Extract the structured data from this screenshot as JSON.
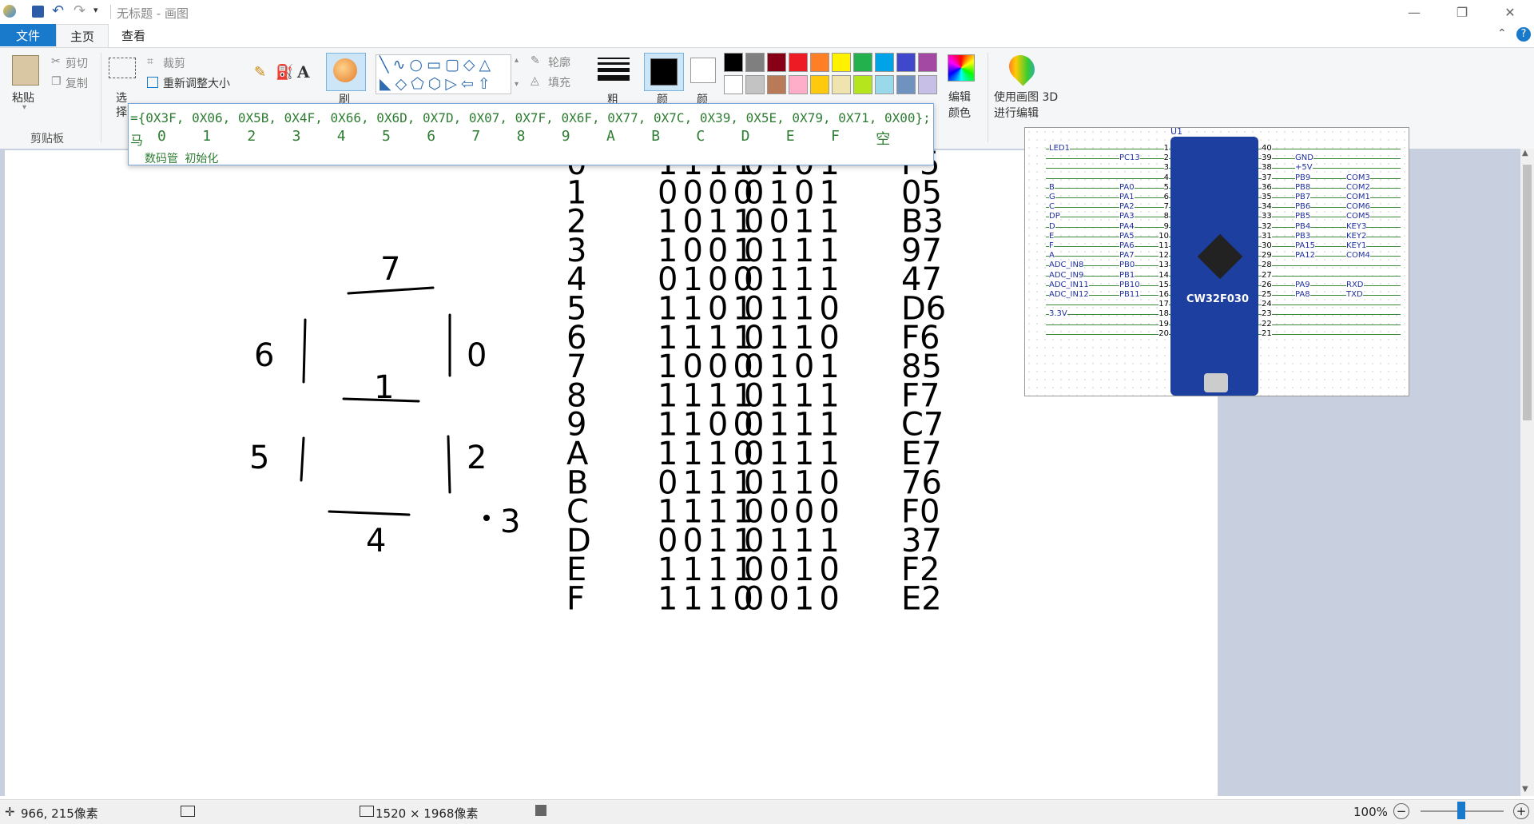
{
  "window": {
    "title": "无标题 - 画图"
  },
  "tabs": {
    "file": "文件",
    "home": "主页",
    "view": "查看"
  },
  "ribbon": {
    "paste": "粘贴",
    "cut": "剪切",
    "copy": "复制",
    "clipboard_group": "剪贴板",
    "select": "选择",
    "crop": "裁剪",
    "resize": "重新调整大小",
    "brush": "刷",
    "outline": "轮廓",
    "fill": "填充",
    "size": "粗",
    "color1": "颜",
    "color2": "颜",
    "edit_colors": "编辑颜色",
    "paint3d": "使用画图 3D 进行编辑",
    "colors": [
      "#000000",
      "#7f7f7f",
      "#880015",
      "#ed1c24",
      "#ff7f27",
      "#fff200",
      "#22b14c",
      "#00a2e8",
      "#3f48cc",
      "#a349a4",
      "#ffffff",
      "#c3c3c3",
      "#b97a57",
      "#ffaec9",
      "#ffc90e",
      "#efe4b0",
      "#b5e61d",
      "#99d9ea",
      "#7092be",
      "#c8bfe7"
    ]
  },
  "code_popup": {
    "line1": "={0X3F, 0X06, 0X5B, 0X4F, 0X66, 0X6D, 0X7D, 0X07, 0X7F, 0X6F, 0X77, 0X7C, 0X39, 0X5E, 0X79, 0X71, 0X00};",
    "line2_prefix": "马",
    "line2_items": [
      "0",
      "1",
      "2",
      "3",
      "4",
      "5",
      "6",
      "7",
      "8",
      "9",
      "A",
      "B",
      "C",
      "D",
      "E",
      "F",
      "空"
    ],
    "line3": "数码管  初始化"
  },
  "drawing": {
    "segments": {
      "top": "7",
      "upper_left": "6",
      "upper_right": "0",
      "middle": "1",
      "lower_left": "5",
      "lower_right": "2",
      "dot": "3",
      "bottom": "4"
    },
    "table": [
      {
        "digit": "0",
        "high": "1111",
        "low": "0101",
        "hex": "F5"
      },
      {
        "digit": "1",
        "high": "0000",
        "low": "0101",
        "hex": "05"
      },
      {
        "digit": "2",
        "high": "1011",
        "low": "0011",
        "hex": "B3"
      },
      {
        "digit": "3",
        "high": "1001",
        "low": "0111",
        "hex": "97"
      },
      {
        "digit": "4",
        "high": "0100",
        "low": "0111",
        "hex": "47"
      },
      {
        "digit": "5",
        "high": "1101",
        "low": "0110",
        "hex": "D6"
      },
      {
        "digit": "6",
        "high": "1111",
        "low": "0110",
        "hex": "F6"
      },
      {
        "digit": "7",
        "high": "1000",
        "low": "0101",
        "hex": "85"
      },
      {
        "digit": "8",
        "high": "1111",
        "low": "0111",
        "hex": "F7"
      },
      {
        "digit": "9",
        "high": "1100",
        "low": "0111",
        "hex": "C7"
      },
      {
        "digit": "A",
        "high": "1110",
        "low": "0111",
        "hex": "E7"
      },
      {
        "digit": "B",
        "high": "0111",
        "low": "0110",
        "hex": "76"
      },
      {
        "digit": "C",
        "high": "1111",
        "low": "0000",
        "hex": "F0"
      },
      {
        "digit": "D",
        "high": "0011",
        "low": "0111",
        "hex": "37"
      },
      {
        "digit": "E",
        "high": "1111",
        "low": "0010",
        "hex": "F2"
      },
      {
        "digit": "F",
        "high": "1110",
        "low": "0010",
        "hex": "E2"
      }
    ]
  },
  "schematic": {
    "chip": "CW32F030",
    "ref": "U1",
    "left_nets": [
      "LED1",
      "",
      "",
      "",
      "B",
      "G",
      "C",
      "DP",
      "D",
      "E",
      "F",
      "A",
      "ADC_IN8",
      "ADC_IN9",
      "ADC_IN11",
      "ADC_IN12",
      "",
      "3.3V",
      "",
      ""
    ],
    "left_pins": [
      "",
      "PC13",
      "",
      "",
      "PA0",
      "PA1",
      "PA2",
      "PA3",
      "PA4",
      "PA5",
      "PA6",
      "PA7",
      "PB0",
      "PB1",
      "PB10",
      "PB11",
      "",
      "",
      "",
      ""
    ],
    "left_nums": [
      "1",
      "2",
      "3",
      "4",
      "5",
      "6",
      "7",
      "8",
      "9",
      "10",
      "11",
      "12",
      "13",
      "14",
      "15",
      "16",
      "17",
      "18",
      "19",
      "20"
    ],
    "right_nums": [
      "40",
      "39",
      "38",
      "37",
      "36",
      "35",
      "34",
      "33",
      "32",
      "31",
      "30",
      "29",
      "28",
      "27",
      "26",
      "25",
      "24",
      "23",
      "22",
      "21"
    ],
    "right_pins": [
      "",
      "GND",
      "+5V",
      "PB9",
      "PB8",
      "PB7",
      "PB6",
      "PB5",
      "PB4",
      "PB3",
      "PA15",
      "PA12",
      "",
      "",
      "PA9",
      "PA8",
      "",
      "",
      "",
      ""
    ],
    "right_nets": [
      "",
      "",
      "",
      "COM3",
      "COM2",
      "COM1",
      "COM6",
      "COM5",
      "KEY3",
      "KEY2",
      "KEY1",
      "COM4",
      "",
      "",
      "RXD",
      "TXD",
      "",
      "",
      "",
      ""
    ]
  },
  "status": {
    "cursor": "966, 215像素",
    "image_size": "1520 × 1968像素",
    "zoom": "100%"
  }
}
